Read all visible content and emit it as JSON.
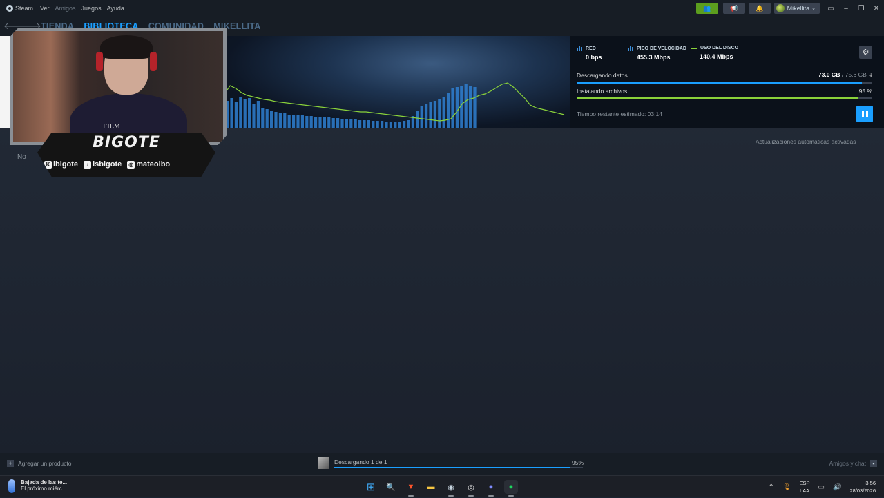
{
  "titlebar": {
    "app_name": "Steam",
    "menu": [
      "Ver",
      "Amigos",
      "Juegos",
      "Ayuda"
    ],
    "username": "Mikellita",
    "friends_icon": "friends-icon",
    "announce_icon": "megaphone-icon",
    "bell_icon": "bell-icon"
  },
  "nav": {
    "tabs": [
      "TIENDA",
      "BIBLIOTECA",
      "COMUNIDAD",
      "MIKELLITA"
    ],
    "active_tab": "BIBLIOTECA"
  },
  "download": {
    "stats": [
      {
        "label": "RED",
        "value": "0 bps"
      },
      {
        "label": "PICO DE VELOCIDAD",
        "value": "455.3 Mbps"
      },
      {
        "label": "USO DEL DISCO",
        "value": "140.4 Mbps"
      }
    ],
    "downloading_label": "Descargando datos",
    "downloaded": "73.0 GB",
    "total": "/ 75.6 GB",
    "download_fraction": 0.965,
    "installing_label": "Instalando archivos",
    "install_percent_text": "95 %",
    "install_fraction": 0.95,
    "eta": "Tiempo restante estimado: 03:14",
    "auto_updates": "Actualizaciones automáticas activadas",
    "empty_text": "No"
  },
  "overlay": {
    "brand": "BIGOTE",
    "shirt_text": "FILM",
    "socials": [
      {
        "icon": "twitch-kick-icon",
        "handle": "ibigote"
      },
      {
        "icon": "tiktok-icon",
        "handle": "isbigote"
      },
      {
        "icon": "instagram-icon",
        "handle": "mateolbo"
      }
    ]
  },
  "statusbar": {
    "add_product": "Agregar un producto",
    "downloading": "Descargando 1 de 1",
    "percent": "95%",
    "progress": 0.95,
    "friends_chat": "Amigos y chat"
  },
  "taskbar": {
    "weather_title": "Bajada de las te...",
    "weather_sub": "El próximo miérc...",
    "lang_1": "ESP",
    "lang_2": "LAA",
    "time": "3:56",
    "date": "28/03/2026"
  },
  "colors": {
    "accent": "#1a9fff",
    "install_green": "#8ad23a",
    "friends_green": "#5c9e1e"
  }
}
